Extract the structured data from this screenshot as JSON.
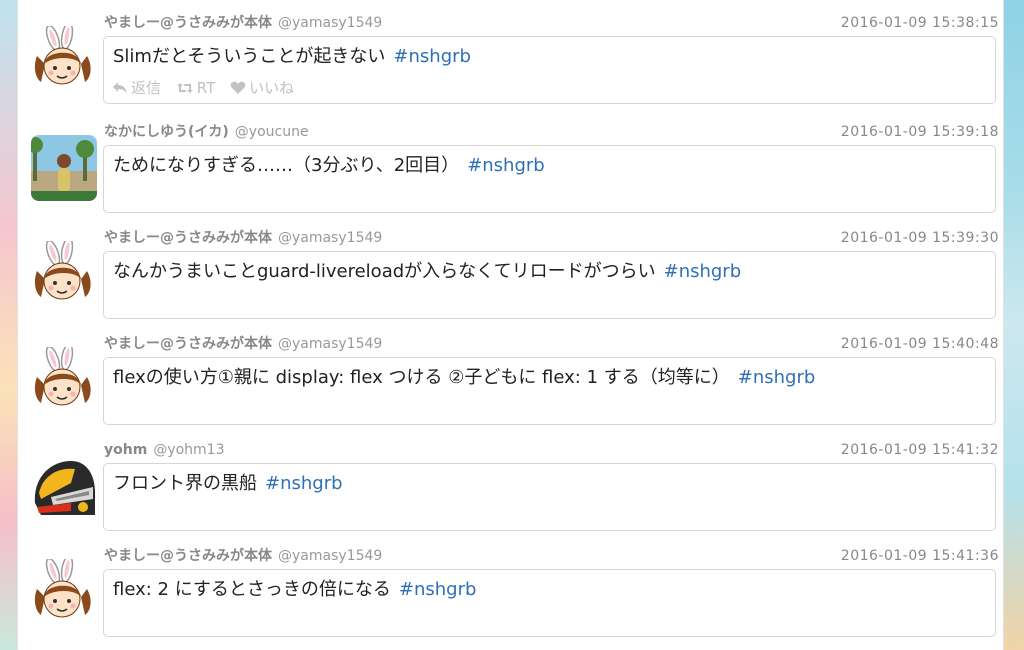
{
  "actions": {
    "reply_label": "返信",
    "rt_label": "RT",
    "like_label": "いいね"
  },
  "colors": {
    "hashtag": "#2f6fb8",
    "meta": "#888888"
  },
  "tweets": [
    {
      "name": "やましー@うさみみが本体",
      "handle": "@yamasy1549",
      "time": "2016-01-09 15:38:15",
      "text": "Slimだとそういうことが起きない",
      "hashtag": "#nshgrb",
      "avatar": "bunny-girl-avatar",
      "show_actions": true
    },
    {
      "name": "なかにしゆう(イカ)",
      "handle": "@youcune",
      "time": "2016-01-09 15:39:18",
      "text": "ためになりすぎる……（3分ぶり、2回目）",
      "hashtag": "#nshgrb",
      "avatar": "photo-avatar",
      "show_actions": false
    },
    {
      "name": "やましー@うさみみが本体",
      "handle": "@yamasy1549",
      "time": "2016-01-09 15:39:30",
      "text": "なんかうまいことguard-livereloadが入らなくてリロードがつらい",
      "hashtag": "#nshgrb",
      "avatar": "bunny-girl-avatar",
      "show_actions": false
    },
    {
      "name": "やましー@うさみみが本体",
      "handle": "@yamasy1549",
      "time": "2016-01-09 15:40:48",
      "text": "flexの使い方①親に display: flex つける ②子どもに flex: 1 する（均等に）",
      "hashtag": "#nshgrb",
      "avatar": "bunny-girl-avatar",
      "show_actions": false
    },
    {
      "name": "yohm",
      "handle": "@yohm13",
      "time": "2016-01-09 15:41:32",
      "text": "フロント界の黒船",
      "hashtag": "#nshgrb",
      "avatar": "helmet-avatar",
      "show_actions": false
    },
    {
      "name": "やましー@うさみみが本体",
      "handle": "@yamasy1549",
      "time": "2016-01-09 15:41:36",
      "text": "flex: 2 にするとさっきの倍になる",
      "hashtag": "#nshgrb",
      "avatar": "bunny-girl-avatar",
      "show_actions": false
    }
  ]
}
